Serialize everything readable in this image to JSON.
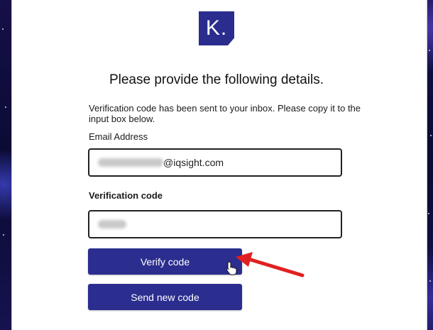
{
  "logo": {
    "text": "K."
  },
  "heading": "Please provide the following details.",
  "info_text": "Verification code has been sent to your inbox. Please copy it to the input box below.",
  "email": {
    "label": "Email Address",
    "value_visible": "@iqsight.com"
  },
  "verification": {
    "label": "Verification code"
  },
  "buttons": {
    "verify": "Verify code",
    "send_new": "Send new code"
  },
  "colors": {
    "brand": "#2b2d8f",
    "annotation_arrow": "#e02020"
  },
  "icons": [
    "hand-pointer-cursor-icon",
    "red-arrow-annotation-icon"
  ]
}
